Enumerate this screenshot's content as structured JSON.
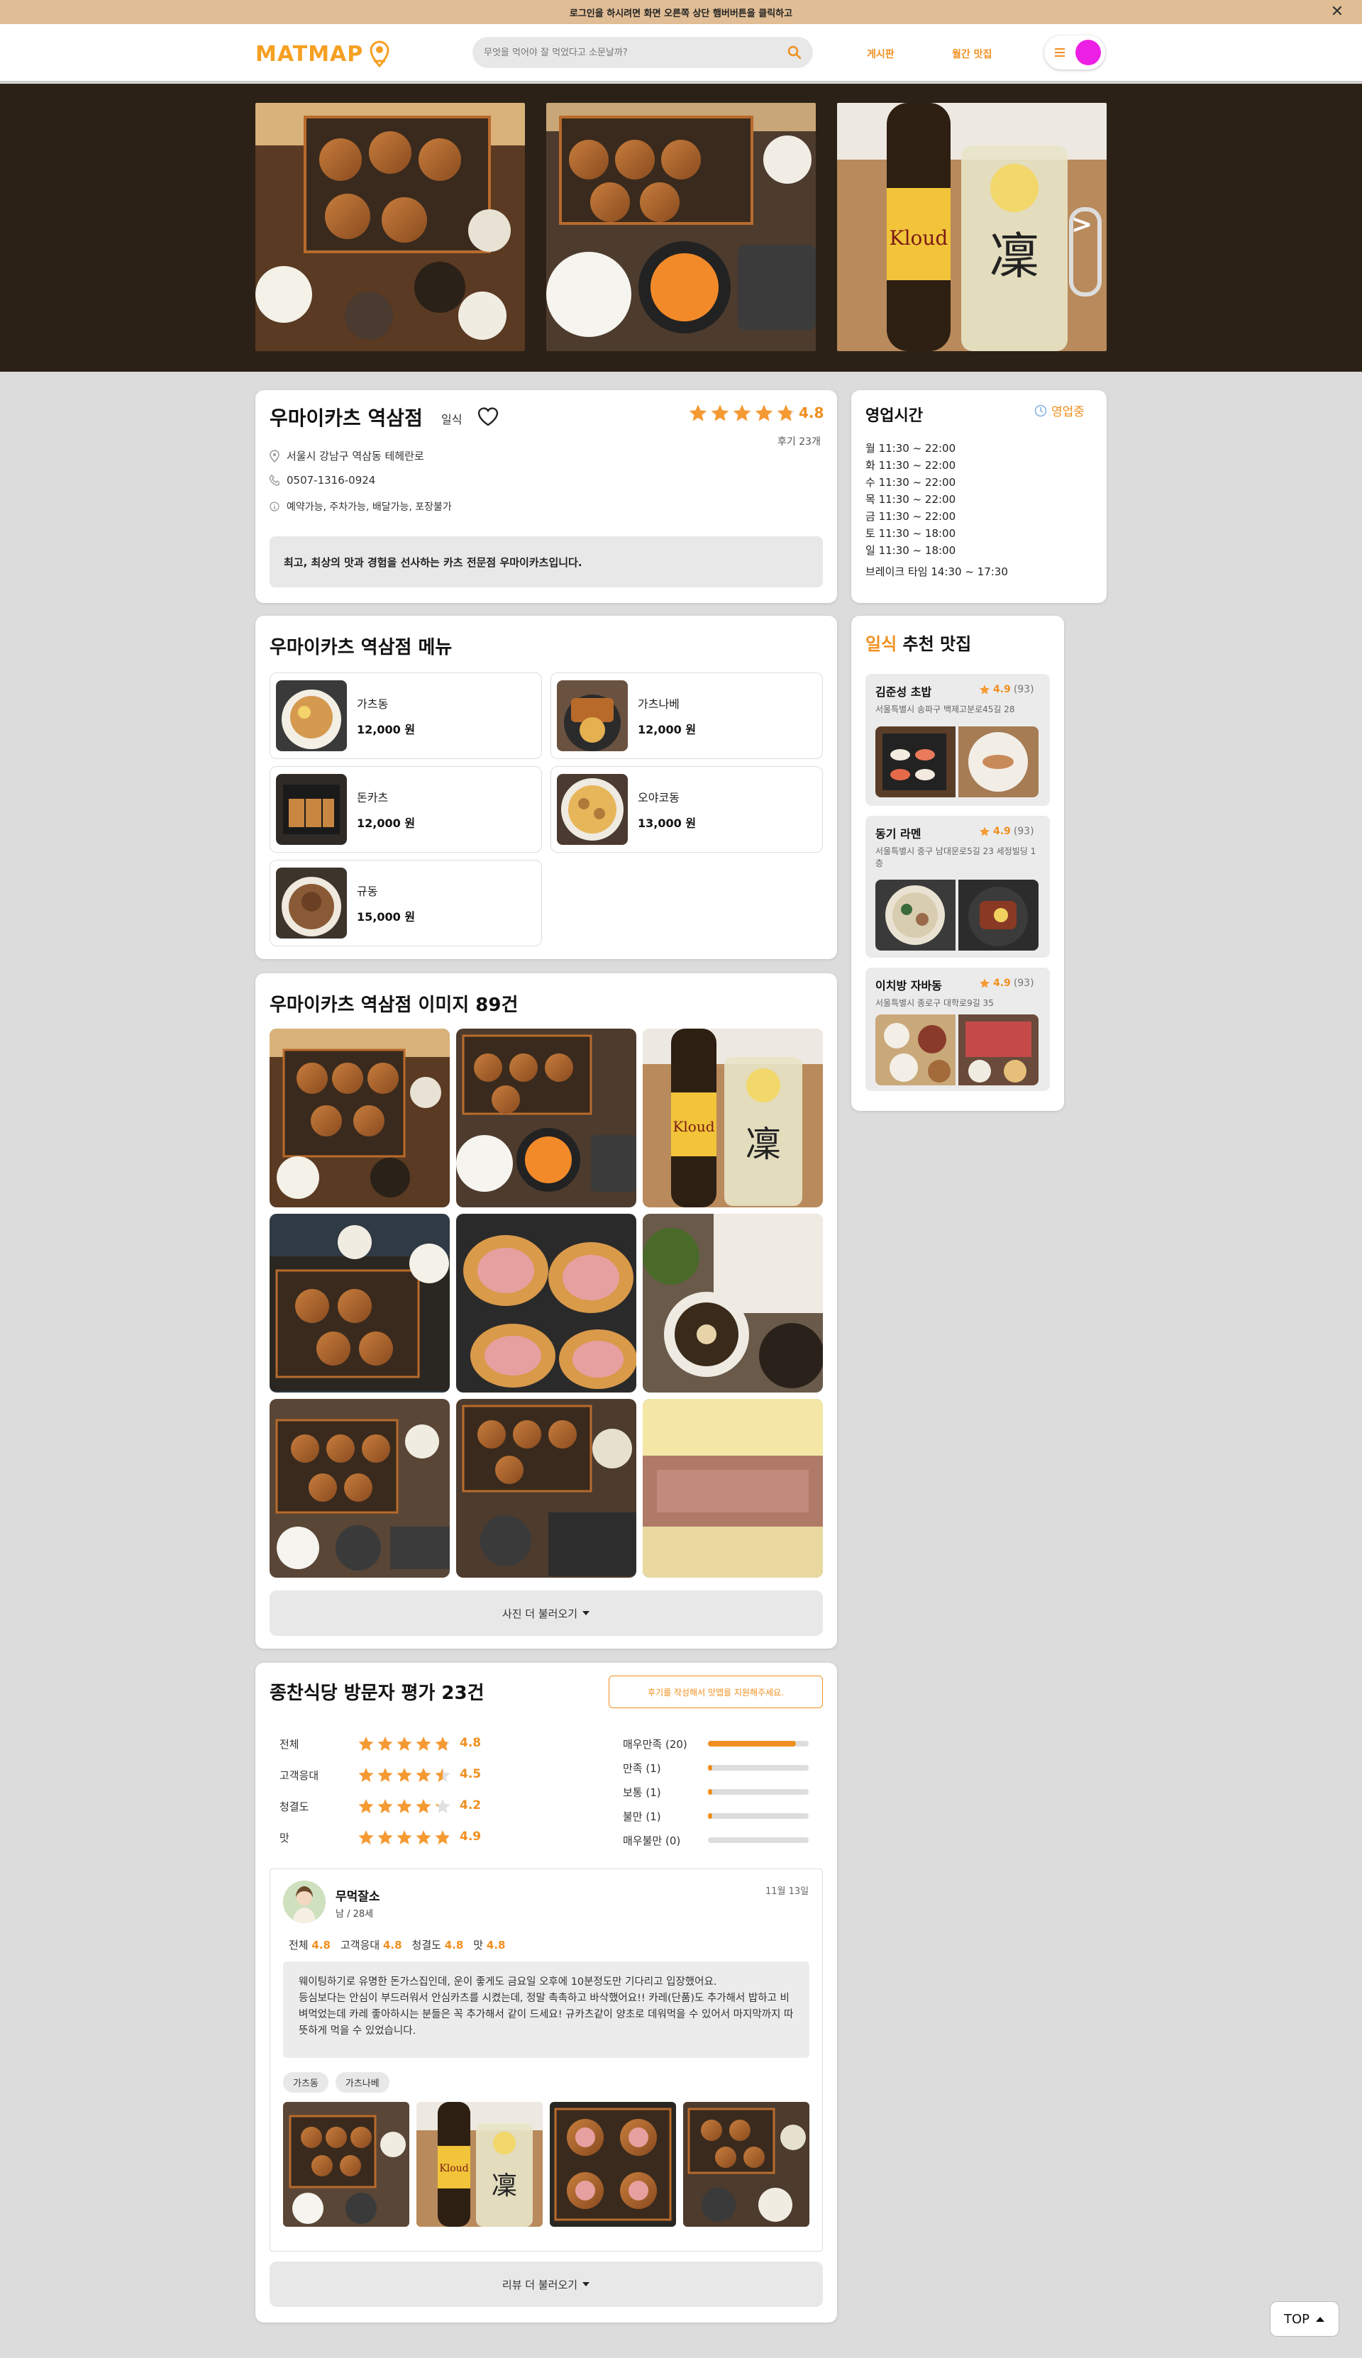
{
  "banner": {
    "text": "로그인을 하시려면 화면 오른쪽 상단 햄버버튼을 클릭하고"
  },
  "header": {
    "logo": "MATMAP",
    "search_placeholder": "무엇을 먹어야 잘 먹었다고 소문날까?",
    "nav_board": "게시판",
    "nav_weekly": "월간 맛집"
  },
  "restaurant": {
    "name": "우마이카츠 역삼점",
    "category": "일식",
    "rating": "4.8",
    "rating_fraction": 0.96,
    "review_count": "후기 23개",
    "address": "서울시 강남구 역삼동 테헤란로",
    "phone": "0507-1316-0924",
    "features": "예약가능, 주차가능, 배달가능, 포장불가",
    "description": "최고, 최상의 맛과 경험을 선사하는 카츠 전문점 우마이카츠입니다."
  },
  "hours": {
    "title": "영업시간",
    "status": "영업중",
    "lines": [
      "월 11:30 ~ 22:00",
      "화 11:30 ~ 22:00",
      "수 11:30 ~ 22:00",
      "목 11:30 ~ 22:00",
      "금 11:30 ~ 22:00",
      "토 11:30 ~ 18:00",
      "일 11:30 ~ 18:00"
    ],
    "break": "브레이크 타임 14:30 ~ 17:30"
  },
  "menu": {
    "title": "우마이카츠 역삼점 메뉴",
    "items": [
      {
        "name": "가츠동",
        "price": "12,000 원"
      },
      {
        "name": "가츠나베",
        "price": "12,000 원"
      },
      {
        "name": "돈카츠",
        "price": "12,000 원"
      },
      {
        "name": "오야코동",
        "price": "13,000 원"
      },
      {
        "name": "규동",
        "price": "15,000 원"
      }
    ]
  },
  "gallery": {
    "title": "우마이카츠 역삼점 이미지 89건",
    "more": "사진 더 불러오기"
  },
  "reviews": {
    "title": "종찬식당 방문자 평가 23건",
    "write_button": "후기를 작성해서 맛맵을 지원해주세요.",
    "categories": [
      {
        "label": "전체",
        "value": "4.8",
        "fraction": 0.96
      },
      {
        "label": "고객응대",
        "value": "4.5",
        "fraction": 0.9
      },
      {
        "label": "청결도",
        "value": "4.2",
        "fraction": 0.84
      },
      {
        "label": "맛",
        "value": "4.9",
        "fraction": 0.98
      }
    ],
    "distribution": [
      {
        "label": "매우만족 (20)",
        "fraction": 0.87
      },
      {
        "label": "만족 (1)",
        "fraction": 0.04
      },
      {
        "label": "보통 (1)",
        "fraction": 0.04
      },
      {
        "label": "불만 (1)",
        "fraction": 0.04
      },
      {
        "label": "매우불만 (0)",
        "fraction": 0
      }
    ],
    "item": {
      "author": "무먹잘소",
      "meta": "남 / 28세",
      "date": "11월 13일",
      "scores": [
        {
          "label": "전체",
          "value": "4.8"
        },
        {
          "label": "고객응대",
          "value": "4.8"
        },
        {
          "label": "청결도",
          "value": "4.8"
        },
        {
          "label": "맛",
          "value": "4.8"
        }
      ],
      "text": "웨이팅하기로 유명한 돈가스집인데, 운이 좋게도 금요일 오후에 10분정도만 기다리고 입장했어요.\n등심보다는 안심이 부드러워서 안심카츠를 시켰는데, 정말 촉촉하고 바삭했어요!! 카레(단품)도 추가해서 밥하고 비벼먹었는데 카레 좋아하시는 분들은 꼭 추가해서 같이 드세요! 규카츠같이 양초로 데워먹을 수 있어서 마지막까지 따뜻하게 먹을 수 있었습니다.",
      "tags": [
        "가츠동",
        "가츠나베"
      ]
    },
    "more": "리뷰 더 불러오기"
  },
  "recommend": {
    "title_accent": "일식",
    "title_rest": "추천 맛집",
    "items": [
      {
        "name": "김준성 초밥",
        "rating": "4.9",
        "count": "(93)",
        "address": "서울특별시 송파구 백제고분로45길 28"
      },
      {
        "name": "동기 라멘",
        "rating": "4.9",
        "count": "(93)",
        "address": "서울특별시 중구 남대문로5길 23 세정빌딩 1층"
      },
      {
        "name": "이치방 자바동",
        "rating": "4.9",
        "count": "(93)",
        "address": "서울특별시 종로구 대학로9길 35"
      }
    ]
  },
  "top_button": "TOP",
  "colors": {
    "accent": "#f08f1f",
    "star": "#f59a33",
    "hero_bg": "#2c2116",
    "banner": "#e0bd95"
  }
}
